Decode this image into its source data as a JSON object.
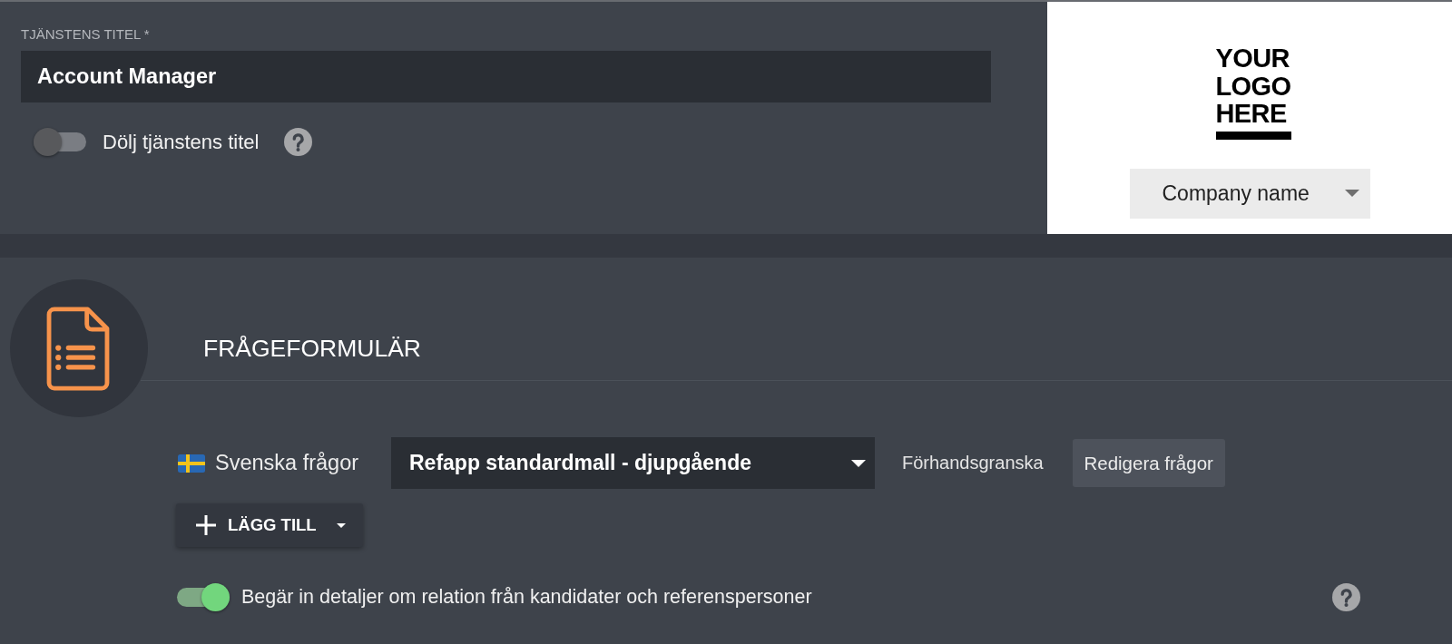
{
  "job_title": {
    "label": "TJÄNSTENS TITEL *",
    "value": "Account Manager"
  },
  "hide_title": {
    "label": "Dölj tjänstens titel",
    "on": false
  },
  "logo": {
    "text": "YOUR LOGO HERE"
  },
  "company_select": {
    "value": "Company name"
  },
  "questionnaire": {
    "title": "FRÅGEFORMULÄR",
    "template_row": {
      "language": "Svenska frågor",
      "template": "Refapp standardmall - djupgående",
      "preview_link": "Förhandsgranska",
      "edit_button": "Redigera frågor"
    },
    "add_button": {
      "label": "LÄGG TILL"
    },
    "relation_details": {
      "label": "Begär in detaljer om relation från kandidater och referenspersoner",
      "on": true
    }
  }
}
